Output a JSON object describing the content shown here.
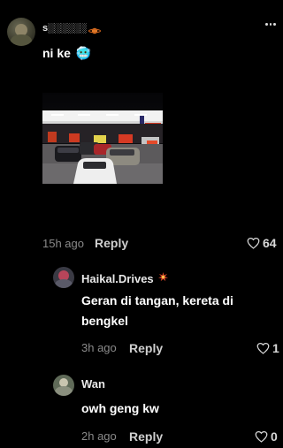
{
  "post": {
    "username": "s░░░░░░",
    "badge_icon": "planet-icon",
    "text": "ni ke",
    "emoji": "🥶",
    "photo_alt": "petrol-station-photo",
    "time": "15h ago",
    "reply_label": "Reply",
    "likes": "64"
  },
  "menu_icon": "more-options-icon",
  "replies": [
    {
      "username": "Haikal.Drives",
      "badge_icon": "burst-icon",
      "text": "Geran di tangan, kereta di bengkel",
      "time": "3h ago",
      "reply_label": "Reply",
      "likes": "1"
    },
    {
      "username": "Wan",
      "text": "owh geng kw",
      "time": "2h ago",
      "reply_label": "Reply",
      "likes": "0"
    }
  ]
}
